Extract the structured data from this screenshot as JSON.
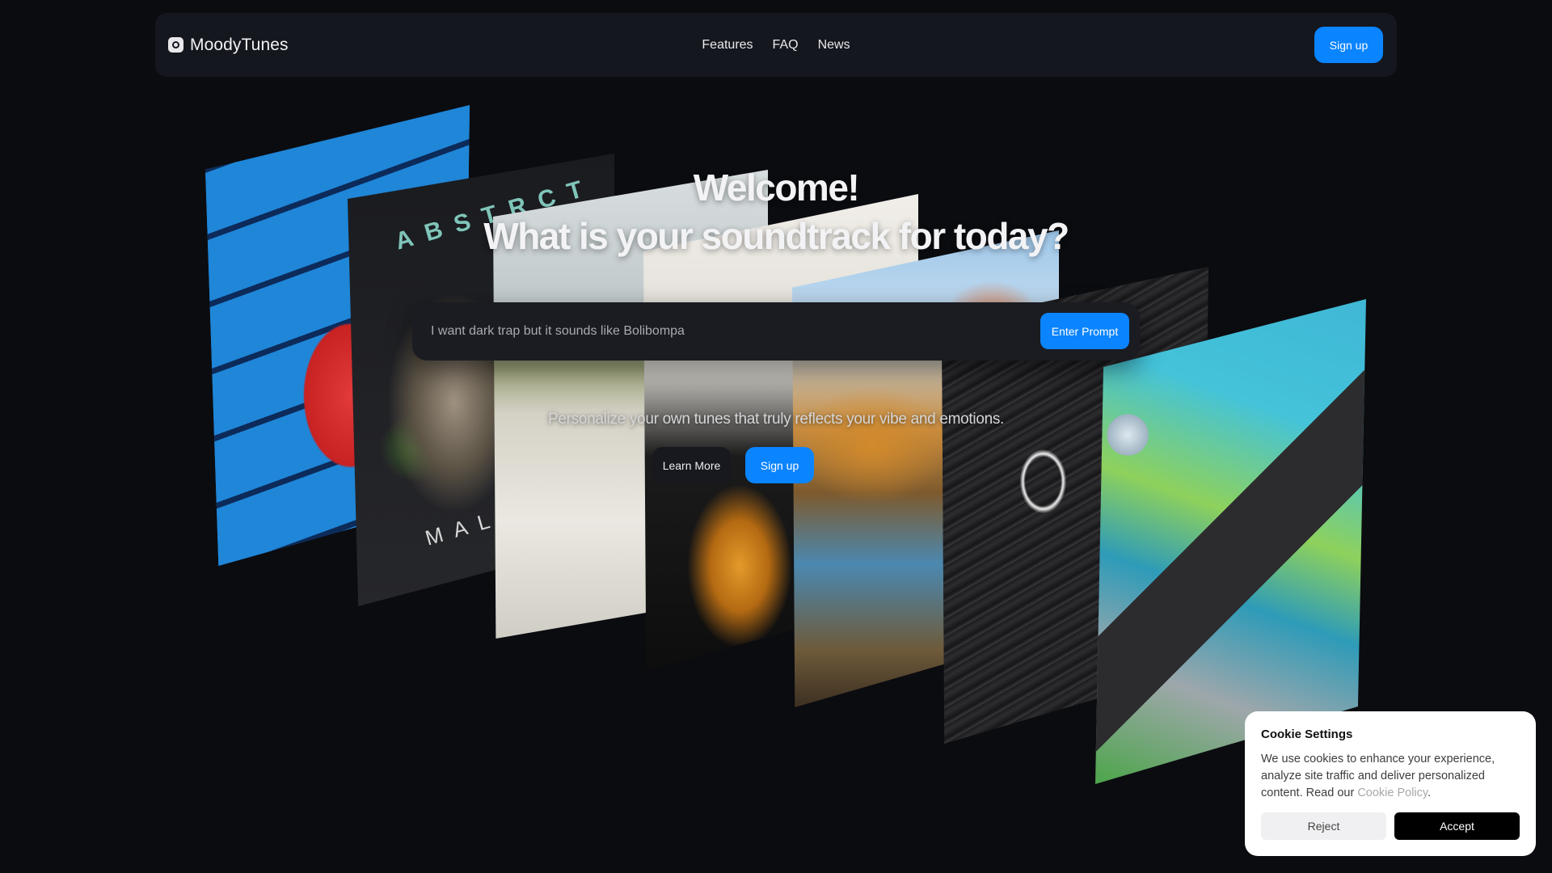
{
  "nav": {
    "brand": "MoodyTunes",
    "links": [
      "Features",
      "FAQ",
      "News"
    ],
    "signup_label": "Sign up"
  },
  "art": {
    "panel2_top_text": "ABSTRCT",
    "panel2_bottom_text": "MAL"
  },
  "hero": {
    "title_line1": "Welcome!",
    "title_line2": "What is your soundtrack for today?",
    "prompt_placeholder": "I want dark trap but it sounds like Bolibompa",
    "prompt_button": "Enter Prompt",
    "subtitle": "Personalize your own tunes that truly reflects your vibe and emotions.",
    "learn_more": "Learn More",
    "signup": "Sign up"
  },
  "cookie": {
    "title": "Cookie Settings",
    "text": "We use cookies to enhance your experience, analyze site traffic and deliver personalized content. Read our",
    "link": "Cookie Policy",
    "period": ".",
    "reject": "Reject",
    "accept": "Accept"
  },
  "colors": {
    "background": "#0b0c10",
    "navbar": "#15171f",
    "accent": "#0a84ff"
  }
}
